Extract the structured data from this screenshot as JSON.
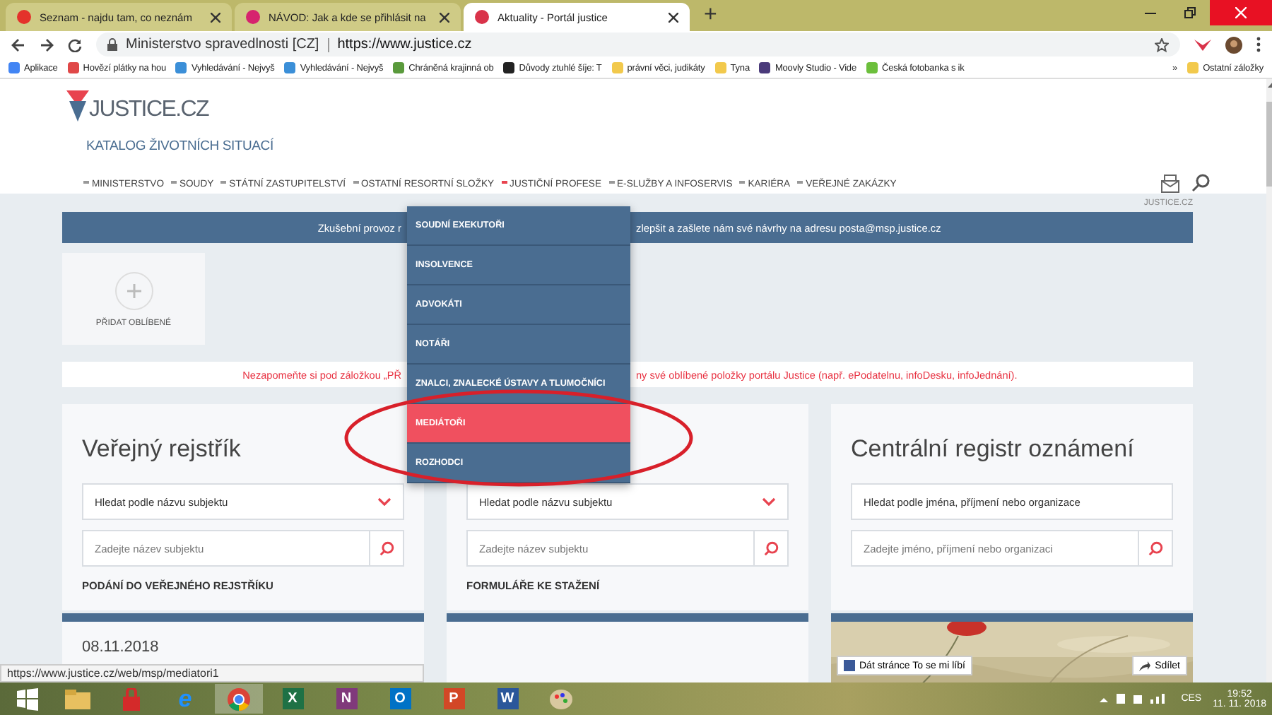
{
  "browser": {
    "tabs": [
      {
        "title": "Seznam - najdu tam, co neznám",
        "selected": false
      },
      {
        "title": "NÁVOD: Jak a kde se přihlásit na",
        "selected": false
      },
      {
        "title": "Aktuality - Portál justice",
        "selected": true
      }
    ],
    "new_tab": "+",
    "address": {
      "site": "Ministerstvo spravedlnosti [CZ]",
      "url": "https://www.justice.cz"
    },
    "bookmarks": [
      {
        "label": "Aplikace",
        "color": "#4285f4"
      },
      {
        "label": "Hovězí plátky na hou",
        "color": "#e04848"
      },
      {
        "label": "Vyhledávání - Nejvyš",
        "color": "#3b8fd8"
      },
      {
        "label": "Vyhledávání - Nejvyš",
        "color": "#3b8fd8"
      },
      {
        "label": "Chráněná krajinná ob",
        "color": "#5a9a3c"
      },
      {
        "label": "Důvody ztuhlé šíje: T",
        "color": "#222222"
      },
      {
        "label": "právní věci, judikáty",
        "color": "#f2c94c"
      },
      {
        "label": "Tyna",
        "color": "#f2c94c"
      },
      {
        "label": "Moovly Studio - Vide",
        "color": "#4a3a7a"
      },
      {
        "label": "Česká fotobanka s ik",
        "color": "#6cbf3c"
      }
    ],
    "more": "»",
    "other": "Ostatní záložky"
  },
  "site": {
    "logo": "JUSTICE.CZ",
    "subtitle": "KATALOG ŽIVOTNÍCH SITUACÍ",
    "nav": [
      {
        "label": "MINISTERSTVO",
        "selected": false
      },
      {
        "label": "SOUDY",
        "selected": false
      },
      {
        "label": "STÁTNÍ ZASTUPITELSTVÍ",
        "selected": false
      },
      {
        "label": "OSTATNÍ RESORTNÍ SLOŽKY",
        "selected": false
      },
      {
        "label": "JUSTIČNÍ PROFESE",
        "selected": true
      },
      {
        "label": "E-SLUŽBY A INFOSERVIS",
        "selected": false
      },
      {
        "label": "KARIÉRA",
        "selected": false
      },
      {
        "label": "VEŘEJNÉ ZAKÁZKY",
        "selected": false
      }
    ],
    "breadcrumb": "JUSTICE.CZ",
    "banner": {
      "left": "Zkušební provoz r",
      "right": "zlepšit a zašlete nám své návrhy na adresu posta@msp.justice.cz"
    },
    "favorite": "PŘIDAT OBLÍBENÉ",
    "notice": {
      "left": "Nezapomeňte si pod záložkou „PŘ",
      "right": "ny své oblíbené položky portálu Justice (např. ePodatelnu, infoDesku, infoJednání)."
    },
    "cards": [
      {
        "title": "Veřejný rejstřík",
        "select": "Hledat podle názvu subjektu",
        "dropdown": true,
        "placeholder": "Zadejte název subjektu",
        "link": "PODÁNÍ DO VEŘEJNÉHO REJSTŘÍKU"
      },
      {
        "select": "Hledat podle názvu subjektu",
        "dropdown": true,
        "placeholder": "Zadejte název subjektu",
        "link": "FORMULÁŘE KE STAŽENÍ"
      },
      {
        "title": "Centrální registr oznámení",
        "select": "Hledat podle jména, příjmení nebo organizace",
        "dropdown": false,
        "placeholder": "Zadejte jméno, příjmení nebo organizaci"
      }
    ],
    "news_date": "08.11.2018",
    "facebook": {
      "like": "Dát stránce To se mi líbí",
      "share": "Sdílet"
    },
    "menu": [
      {
        "label": "SOUDNÍ EXEKUTOŘI",
        "selected": false
      },
      {
        "label": "INSOLVENCE",
        "selected": false
      },
      {
        "label": "ADVOKÁTI",
        "selected": false
      },
      {
        "label": "NOTÁŘI",
        "selected": false
      },
      {
        "label": "ZNALCI, ZNALECKÉ ÚSTAVY A TLUMOČNÍCI",
        "selected": false
      },
      {
        "label": "MEDIÁTOŘI",
        "selected": true
      },
      {
        "label": "ROZHODCI",
        "selected": false
      }
    ]
  },
  "status_url": "https://www.justice.cz/web/msp/mediatori1",
  "taskbar": {
    "apps": [
      {
        "kind": "folder",
        "selected": false
      },
      {
        "kind": "lock",
        "selected": false
      },
      {
        "kind": "ie",
        "label": "e",
        "selected": false
      },
      {
        "kind": "chrome",
        "selected": true
      },
      {
        "kind": "office",
        "label": "X",
        "color": "#1e7145",
        "selected": false
      },
      {
        "kind": "office",
        "label": "N",
        "color": "#80397b",
        "selected": false
      },
      {
        "kind": "office",
        "label": "O",
        "color": "#0072c6",
        "selected": false
      },
      {
        "kind": "office",
        "label": "P",
        "color": "#d24726",
        "selected": false
      },
      {
        "kind": "office",
        "label": "W",
        "color": "#2b579a",
        "selected": false
      },
      {
        "kind": "paint",
        "selected": false
      }
    ],
    "lang": "CES",
    "time": "19:52",
    "date": "11. 11. 2018"
  }
}
